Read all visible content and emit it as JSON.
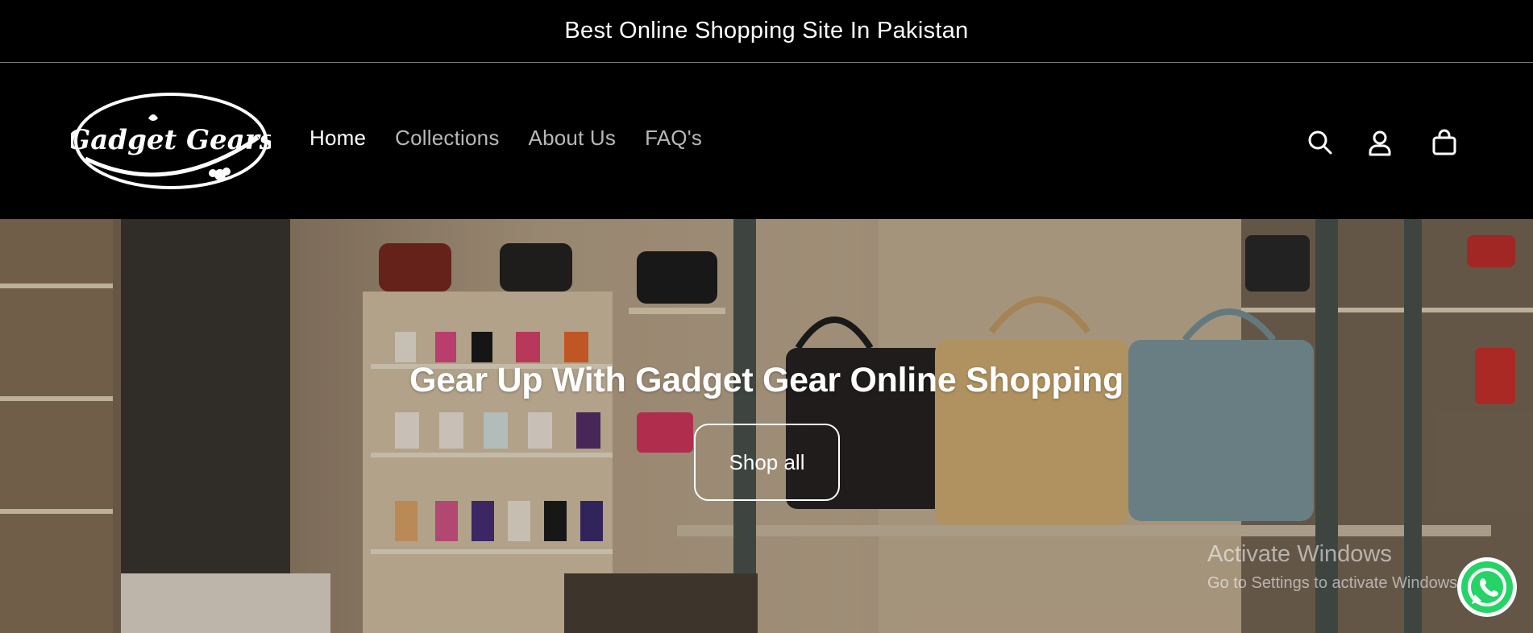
{
  "announcement": {
    "text": "Best Online Shopping Site In Pakistan"
  },
  "header": {
    "logo_text": "Gadget Gears",
    "nav": [
      {
        "label": "Home",
        "active": true
      },
      {
        "label": "Collections",
        "active": false
      },
      {
        "label": "About Us",
        "active": false
      },
      {
        "label": "FAQ's",
        "active": false
      }
    ],
    "icons": [
      "search-icon",
      "account-icon",
      "cart-icon"
    ]
  },
  "hero": {
    "title": "Gear Up With Gadget Gear Online Shopping",
    "button_label": "Shop all"
  },
  "os_watermark": {
    "line1": "Activate Windows",
    "line2": "Go to Settings to activate Windows."
  },
  "floating": {
    "icon": "whatsapp-icon",
    "color": "#25D366"
  },
  "colors": {
    "background": "#000000",
    "text": "#ffffff",
    "nav_inactive": "#b8b8b8"
  }
}
